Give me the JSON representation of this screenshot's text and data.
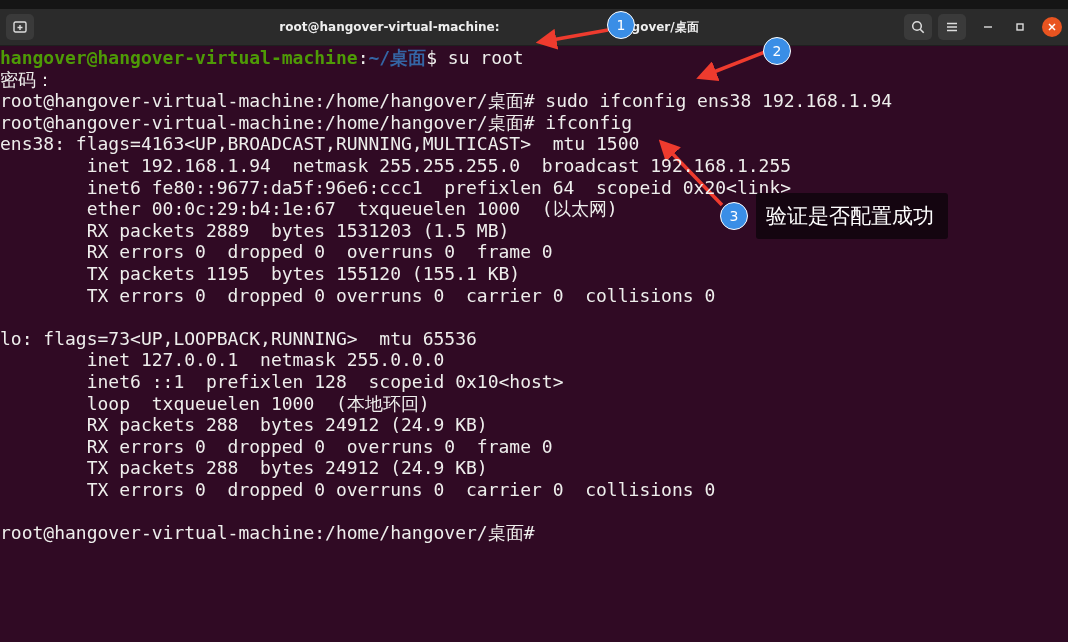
{
  "window": {
    "title_visible_start": "root@hangover-virtual-machine:",
    "title_visible_end": "gover/桌面"
  },
  "terminal": {
    "blocks": [
      [
        [
          {
            "kind": "user",
            "text": "hangover@hangover-virtual-machine"
          },
          {
            "kind": "plain",
            "text": ":"
          },
          {
            "kind": "path",
            "text": "~/桌面"
          },
          {
            "kind": "plain",
            "text": "$ su root"
          }
        ],
        [
          {
            "kind": "plain",
            "text": "密码："
          }
        ],
        [
          {
            "kind": "plain",
            "text": "root@hangover-virtual-machine:/home/hangover/桌面# sudo ifconfig ens38 192.168.1.94"
          }
        ],
        [
          {
            "kind": "plain",
            "text": "root@hangover-virtual-machine:/home/hangover/桌面# ifconfig"
          }
        ],
        [
          {
            "kind": "plain",
            "text": "ens38: flags=4163<UP,BROADCAST,RUNNING,MULTICAST>  mtu 1500"
          }
        ],
        [
          {
            "kind": "plain",
            "text": "        inet 192.168.1.94  netmask 255.255.255.0  broadcast 192.168.1.255"
          }
        ],
        [
          {
            "kind": "plain",
            "text": "        inet6 fe80::9677:da5f:96e6:ccc1  prefixlen 64  scopeid 0x20<link>"
          }
        ],
        [
          {
            "kind": "plain",
            "text": "        ether 00:0c:29:b4:1e:67  txqueuelen 1000  (以太网)"
          }
        ],
        [
          {
            "kind": "plain",
            "text": "        RX packets 2889  bytes 1531203 (1.5 MB)"
          }
        ],
        [
          {
            "kind": "plain",
            "text": "        RX errors 0  dropped 0  overruns 0  frame 0"
          }
        ],
        [
          {
            "kind": "plain",
            "text": "        TX packets 1195  bytes 155120 (155.1 KB)"
          }
        ],
        [
          {
            "kind": "plain",
            "text": "        TX errors 0  dropped 0 overruns 0  carrier 0  collisions 0"
          }
        ]
      ],
      [
        [
          {
            "kind": "plain",
            "text": "lo: flags=73<UP,LOOPBACK,RUNNING>  mtu 65536"
          }
        ],
        [
          {
            "kind": "plain",
            "text": "        inet 127.0.0.1  netmask 255.0.0.0"
          }
        ],
        [
          {
            "kind": "plain",
            "text": "        inet6 ::1  prefixlen 128  scopeid 0x10<host>"
          }
        ],
        [
          {
            "kind": "plain",
            "text": "        loop  txqueuelen 1000  (本地环回)"
          }
        ],
        [
          {
            "kind": "plain",
            "text": "        RX packets 288  bytes 24912 (24.9 KB)"
          }
        ],
        [
          {
            "kind": "plain",
            "text": "        RX errors 0  dropped 0  overruns 0  frame 0"
          }
        ],
        [
          {
            "kind": "plain",
            "text": "        TX packets 288  bytes 24912 (24.9 KB)"
          }
        ],
        [
          {
            "kind": "plain",
            "text": "        TX errors 0  dropped 0 overruns 0  carrier 0  collisions 0"
          }
        ]
      ],
      [
        [
          {
            "kind": "plain",
            "text": "root@hangover-virtual-machine:/home/hangover/桌面#"
          }
        ]
      ]
    ]
  },
  "annotations": [
    {
      "number": "1"
    },
    {
      "number": "2"
    },
    {
      "number": "3",
      "callout": "验证是否配置成功"
    }
  ]
}
